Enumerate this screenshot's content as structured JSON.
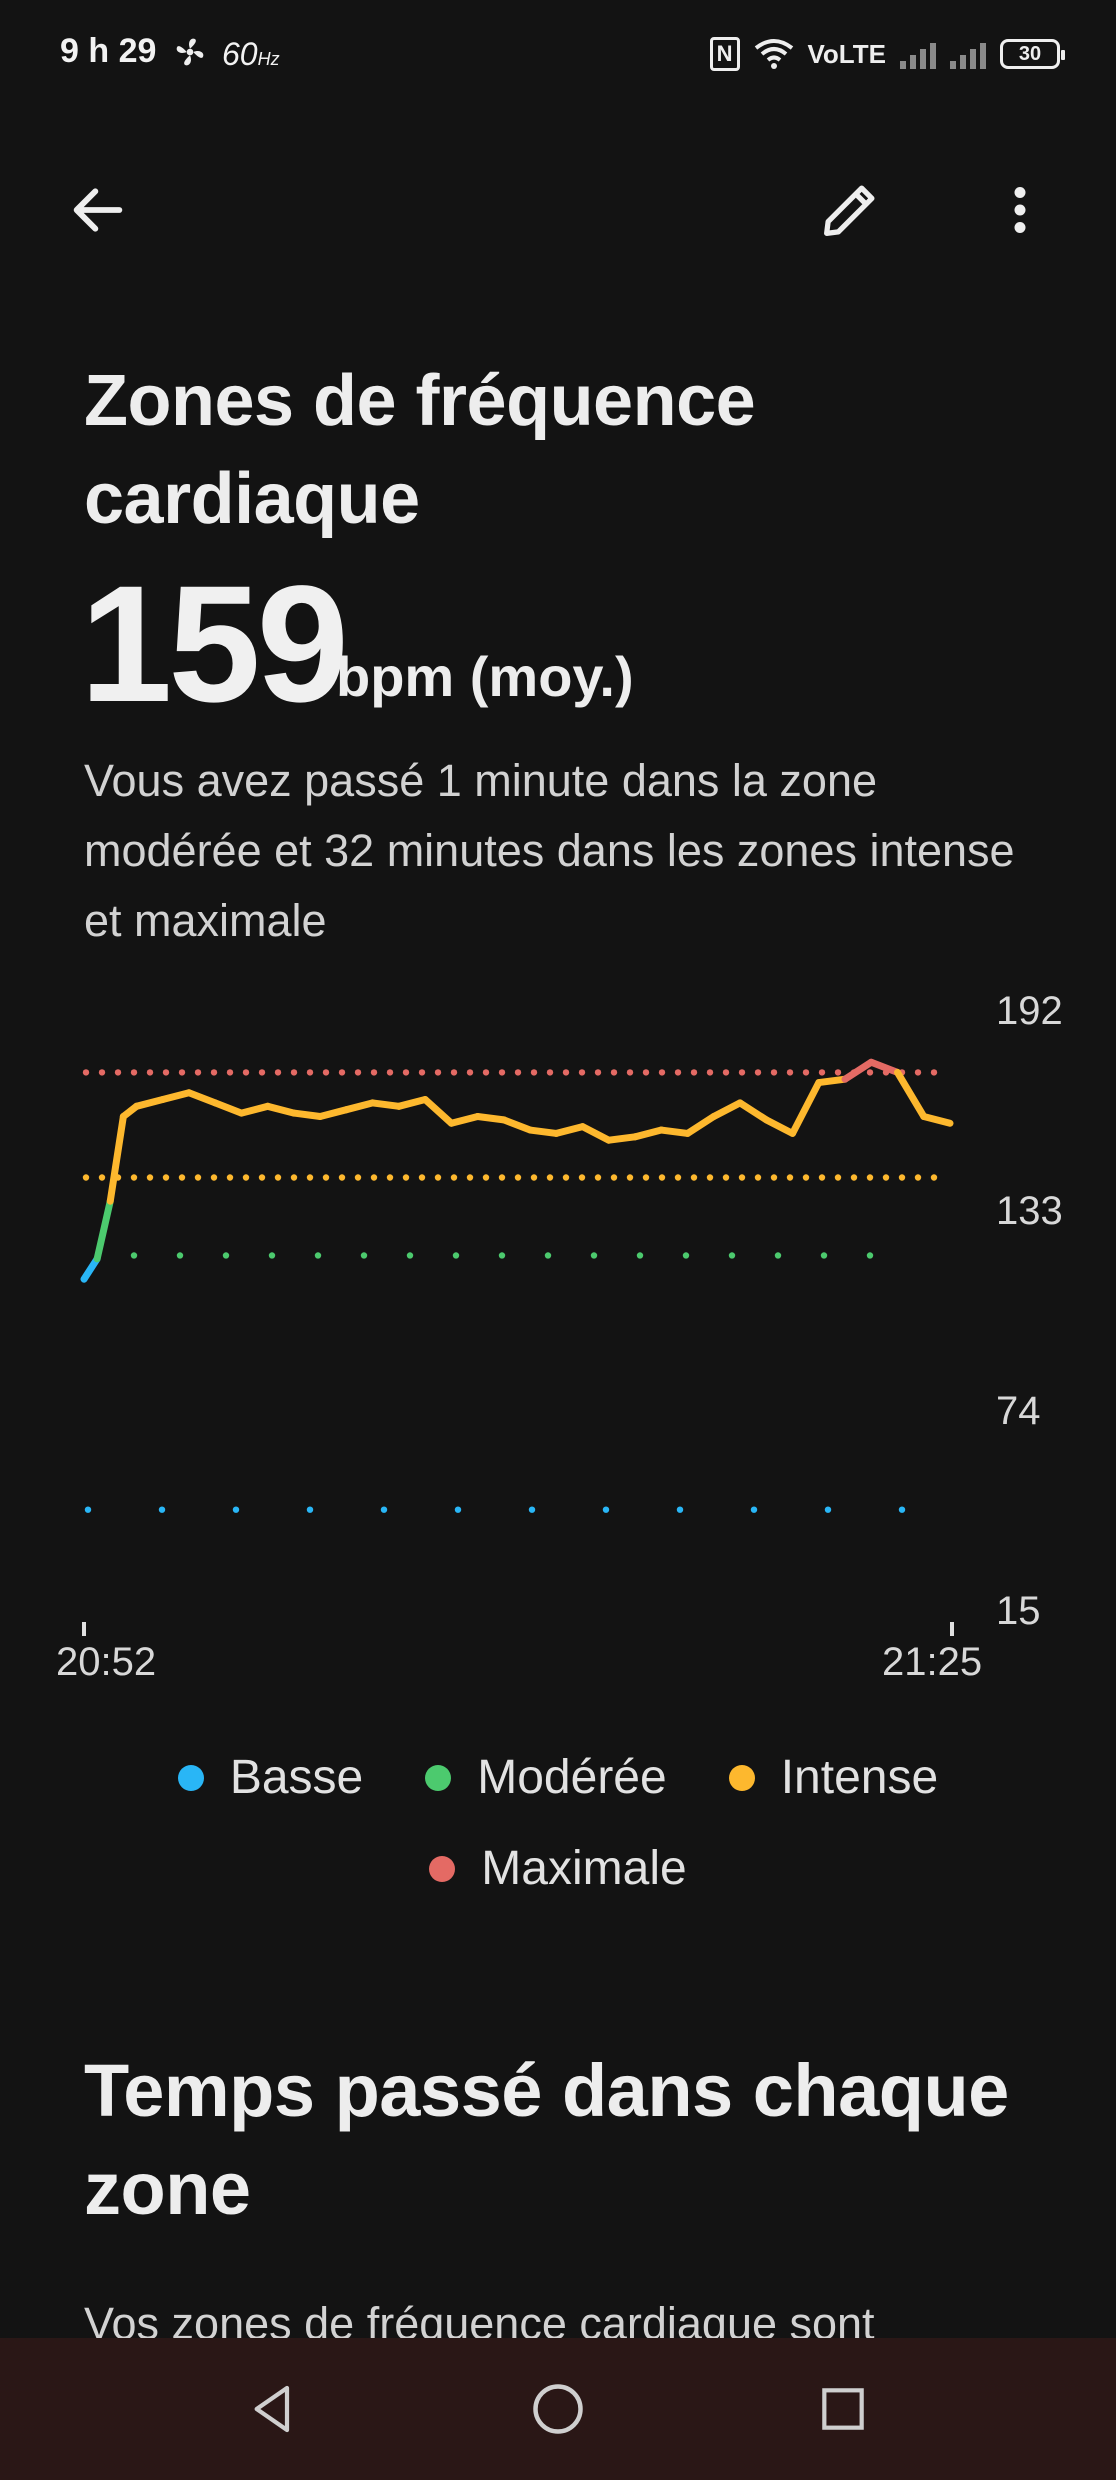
{
  "status_bar": {
    "time": "9 h 29",
    "refresh_rate": "60",
    "refresh_unit": "Hz",
    "network": "VoLTE",
    "battery": "30"
  },
  "header": {
    "title": "Zones de fréquence cardiaque",
    "value": "159",
    "unit": "bpm (moy.)",
    "summary": "Vous avez passé 1 minute dans la zone modérée et 32 minutes dans les zones intense et maximale"
  },
  "chart_data": {
    "type": "line",
    "x_start": "20:52",
    "x_end": "21:25",
    "y_ticks": [
      192,
      133,
      74,
      15
    ],
    "ylim": [
      15,
      192
    ],
    "zone_thresholds": [
      {
        "zone": "Basse",
        "value": 44
      },
      {
        "zone": "Modérée",
        "value": 119
      },
      {
        "zone": "Intense",
        "value": 142
      },
      {
        "zone": "Maximale",
        "value": 173
      }
    ],
    "x_minutes": [
      0,
      0.5,
      1,
      1.5,
      2,
      3,
      4,
      5,
      6,
      7,
      8,
      9,
      10,
      11,
      12,
      13,
      14,
      15,
      16,
      17,
      18,
      19,
      20,
      21,
      22,
      23,
      24,
      25,
      26,
      27,
      28,
      29,
      30,
      31,
      32,
      33
    ],
    "values": [
      112,
      118,
      135,
      160,
      163,
      165,
      167,
      164,
      161,
      163,
      161,
      160,
      162,
      164,
      163,
      165,
      158,
      160,
      159,
      156,
      155,
      157,
      153,
      154,
      156,
      155,
      160,
      164,
      159,
      155,
      170,
      171,
      176,
      173,
      160,
      158
    ],
    "series_colors": {
      "Basse": "#29b6f6",
      "Modérée": "#4cca6e",
      "Intense": "#fdb82e",
      "Maximale": "#e46a64"
    }
  },
  "legend": [
    {
      "label": "Basse",
      "color": "#29b6f6"
    },
    {
      "label": "Modérée",
      "color": "#4cca6e"
    },
    {
      "label": "Intense",
      "color": "#fdb82e"
    },
    {
      "label": "Maximale",
      "color": "#e46a64"
    }
  ],
  "section": {
    "title": "Temps passé dans chaque zone",
    "body": "Vos zones de fréquence cardiaque sont"
  }
}
